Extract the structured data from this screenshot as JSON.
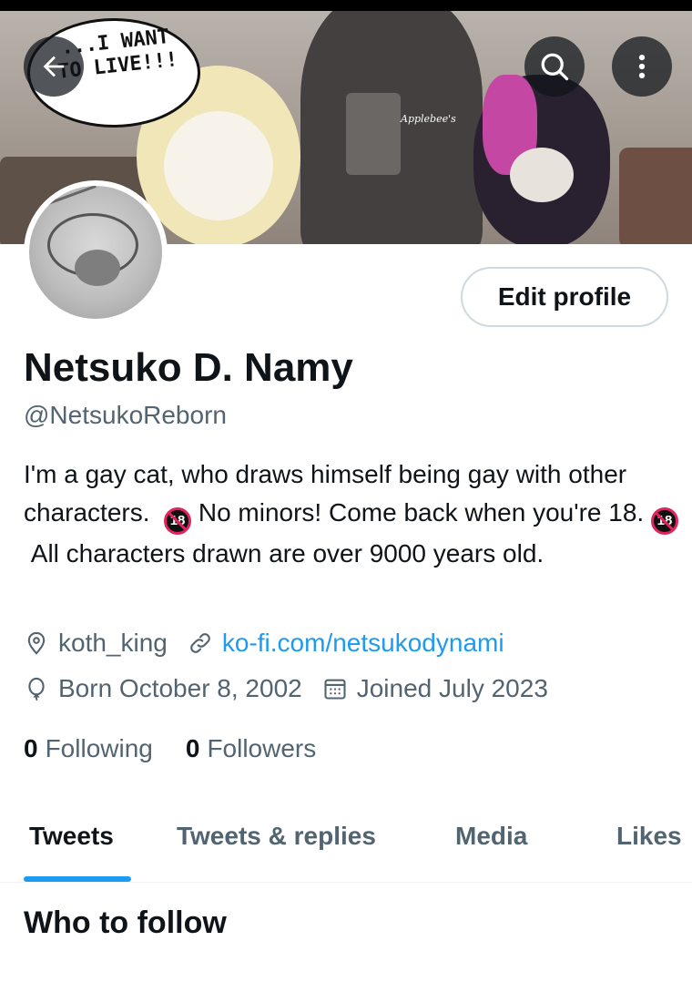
{
  "banner": {
    "speech_text": "...I WANT TO LIVE!!!",
    "shirt_logo": "Applebee's"
  },
  "profile": {
    "display_name": "Netsuko D. Namy",
    "handle": "@NetsukoReborn",
    "bio_part1": "I'm a gay cat, who draws himself being gay with other characters.",
    "bio_part2": "No minors! Come back when you're 18.",
    "bio_part3": "All characters drawn are over 9000 years old.",
    "badge_text": "18",
    "location": "koth_king",
    "website": "ko-fi.com/netsukodynami",
    "birthday": "Born October 8, 2002",
    "joined": "Joined July 2023"
  },
  "actions": {
    "edit_profile_label": "Edit profile"
  },
  "stats": {
    "following_count": "0",
    "following_label": "Following",
    "followers_count": "0",
    "followers_label": "Followers"
  },
  "tabs": [
    {
      "label": "Tweets",
      "active": true
    },
    {
      "label": "Tweets & replies",
      "active": false
    },
    {
      "label": "Media",
      "active": false
    },
    {
      "label": "Likes",
      "active": false
    }
  ],
  "section": {
    "who_to_follow": "Who to follow"
  },
  "icons": {
    "back": "arrow-left-icon",
    "search": "search-icon",
    "more": "more-vertical-icon",
    "location": "location-pin-icon",
    "link": "link-icon",
    "birthday": "balloon-icon",
    "calendar": "calendar-icon"
  },
  "colors": {
    "accent": "#1d9bf0",
    "text_primary": "#0f1419",
    "text_secondary": "#536471"
  }
}
